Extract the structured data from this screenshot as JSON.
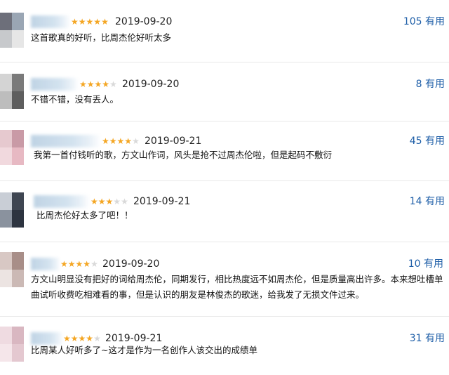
{
  "reviews": [
    {
      "date": "2019-09-20",
      "rating": 5,
      "useful_count": "105",
      "useful_label": "有用",
      "content": "这首歌真的好听，比周杰伦好听太多"
    },
    {
      "date": "2019-09-20",
      "rating": 4,
      "useful_count": "8",
      "useful_label": "有用",
      "content": "不错不错，没有丢人。"
    },
    {
      "date": "2019-09-21",
      "rating": 4,
      "useful_count": "45",
      "useful_label": "有用",
      "content": "我第一首付钱听的歌，方文山作词，风头是抢不过周杰伦啦，但是起码不敷衍"
    },
    {
      "date": "2019-09-21",
      "rating": 3,
      "useful_count": "14",
      "useful_label": "有用",
      "content": "比周杰伦好太多了吧！！"
    },
    {
      "date": "2019-09-20",
      "rating": 4,
      "useful_count": "10",
      "useful_label": "有用",
      "content": "方文山明显没有把好的词给周杰伦，同期发行，相比热度远不如周杰伦，但是质量高出许多。本来想吐槽单曲试听收费吃相难看的事，但是认识的朋友是林俊杰的歌迷，给我发了无损文件过来。"
    },
    {
      "date": "2019-09-21",
      "rating": 4,
      "useful_count": "31",
      "useful_label": "有用",
      "content": "比周某人好听多了~这才是作为一名创作人该交出的成绩单"
    }
  ],
  "colors": {
    "star_on": "#f4a623",
    "star_off": "#d9d9d9",
    "useful": "#1f5fa8",
    "divider": "#e8e8e8"
  }
}
